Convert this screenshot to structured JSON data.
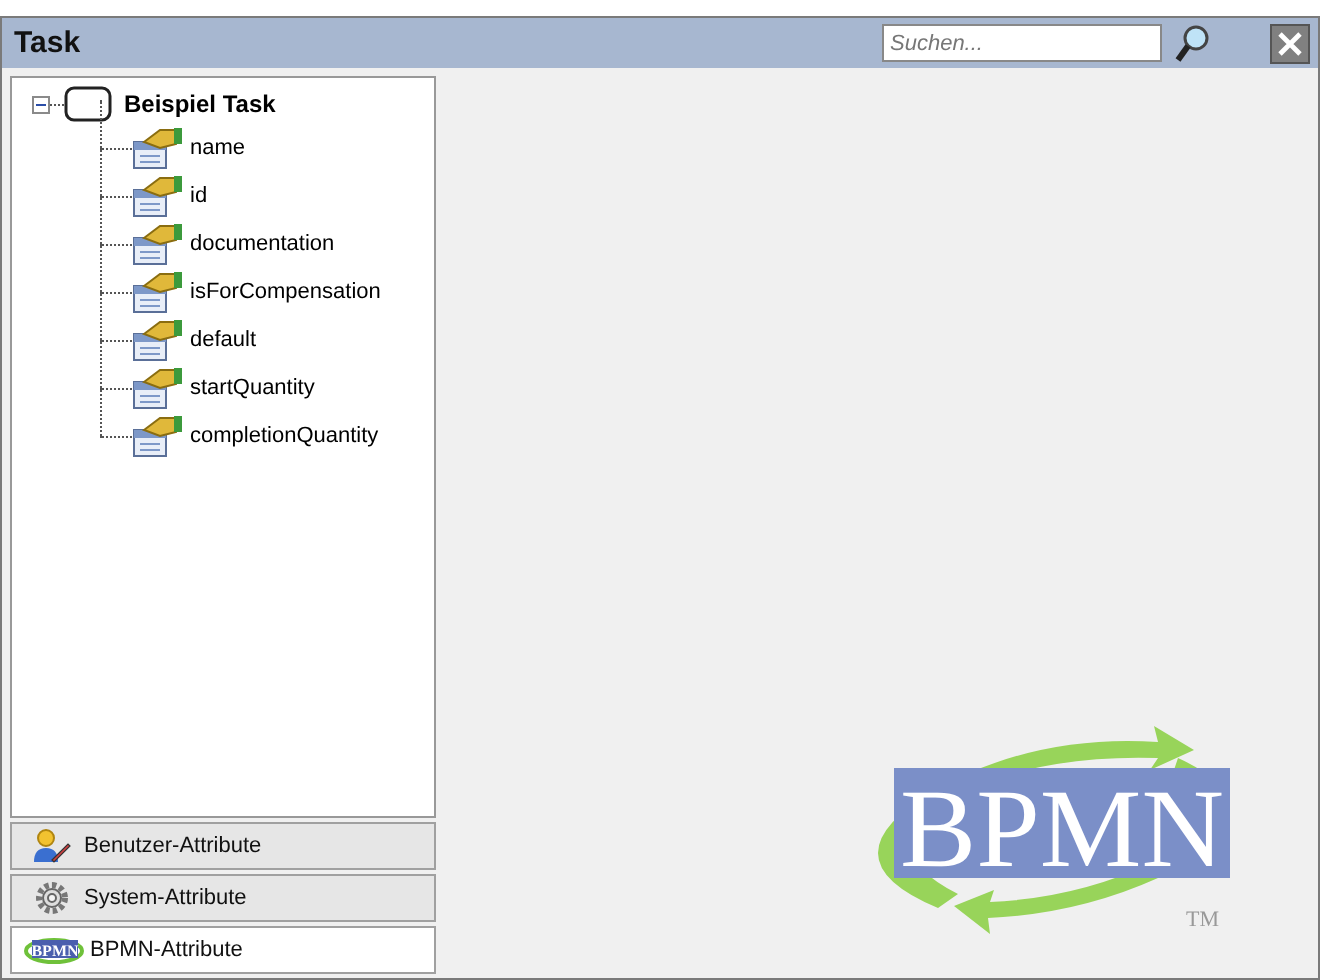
{
  "window": {
    "title": "Task"
  },
  "search": {
    "placeholder": "Suchen..."
  },
  "tree": {
    "label": "Beispiel Task",
    "expanded": true,
    "children": [
      {
        "label": "name"
      },
      {
        "label": "id"
      },
      {
        "label": "documentation"
      },
      {
        "label": "isForCompensation"
      },
      {
        "label": "default"
      },
      {
        "label": "startQuantity"
      },
      {
        "label": "completionQuantity"
      }
    ]
  },
  "tabs": [
    {
      "label": "Benutzer-Attribute",
      "kind": "user",
      "selected": false
    },
    {
      "label": "System-Attribute",
      "kind": "system",
      "selected": false
    },
    {
      "label": "BPMN-Attribute",
      "kind": "bpmn",
      "icon_text": "BPMN",
      "selected": true
    }
  ],
  "logo": {
    "text": "BPMN",
    "trademark": "TM"
  }
}
